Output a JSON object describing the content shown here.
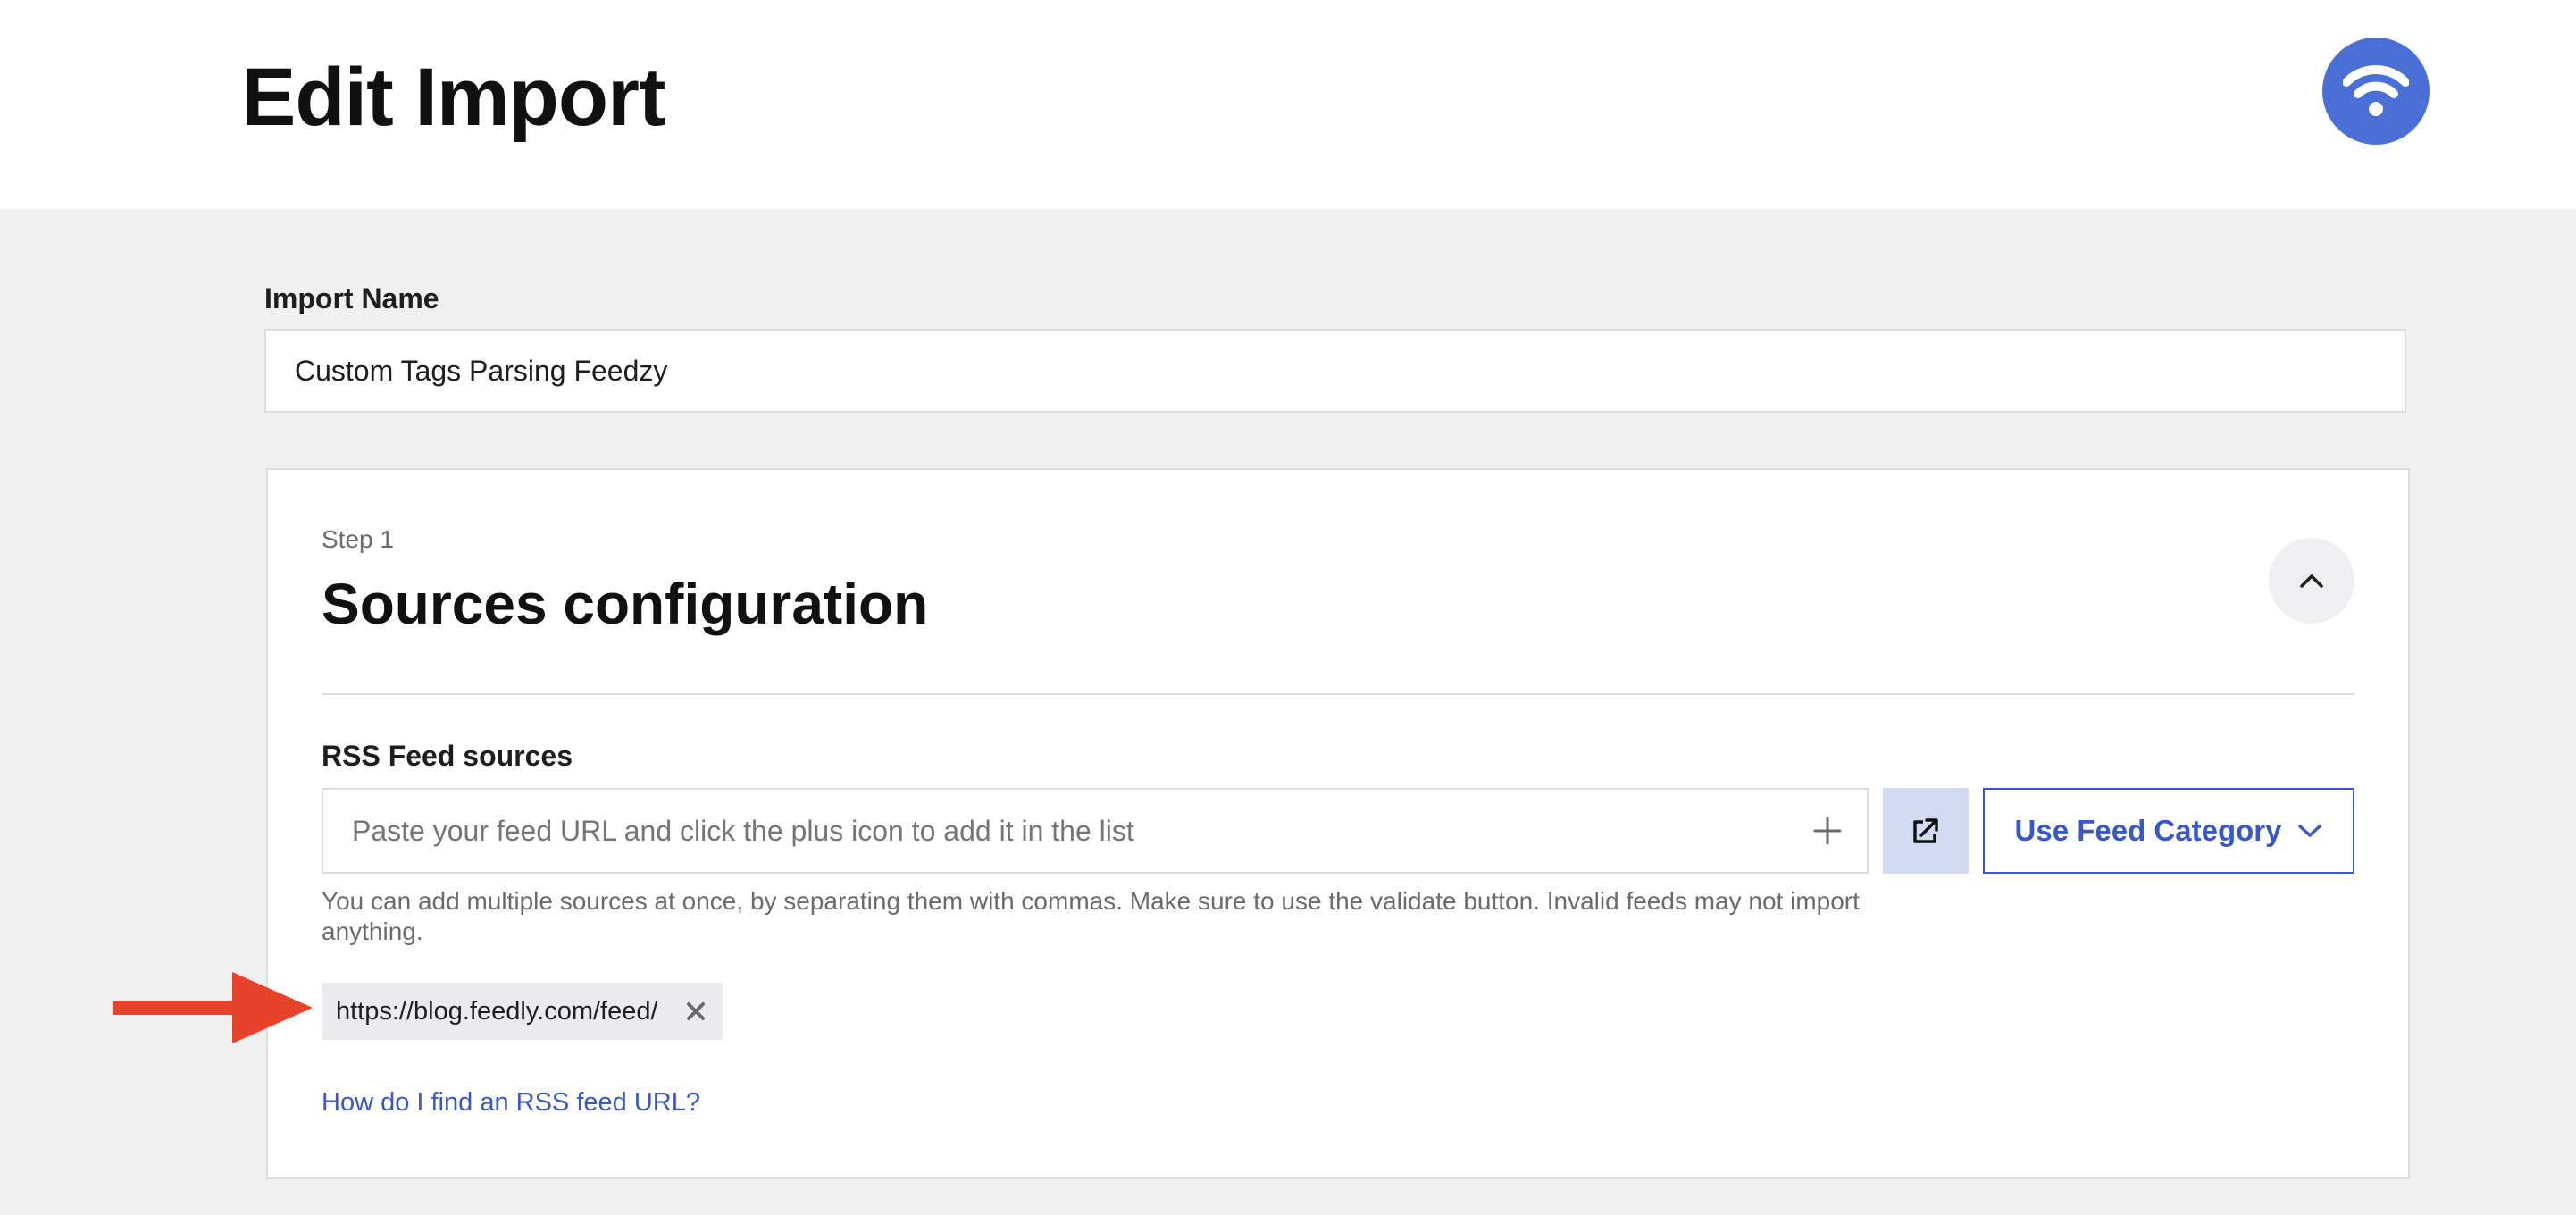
{
  "header": {
    "title": "Edit Import",
    "logo_icon": "wifi-icon",
    "logo_color": "#4a6fd6"
  },
  "import_name": {
    "label": "Import Name",
    "value": "Custom Tags Parsing Feedzy"
  },
  "step": {
    "label": "Step 1",
    "title": "Sources configuration",
    "collapse_icon": "chevron-up-icon"
  },
  "rss": {
    "label": "RSS Feed sources",
    "placeholder": "Paste your feed URL and click the plus icon to add it in the list",
    "add_icon": "plus-icon",
    "validate_icon": "external-link-icon",
    "category_button": "Use Feed Category",
    "category_icon": "chevron-down-icon",
    "help_text": "You can add multiple sources at once, by separating them with commas. Make sure to use the validate button. Invalid feeds may not import anything.",
    "tags": [
      {
        "label": "https://blog.feedly.com/feed/",
        "remove_icon": "close-icon"
      }
    ],
    "help_link": "How do I find an RSS feed URL?"
  },
  "annotation": {
    "arrow_icon": "arrow-right-icon",
    "arrow_color": "#e8422a"
  },
  "colors": {
    "accent": "#3858c9",
    "background": "#f0f0f0",
    "validate_bg": "#d3dbf3"
  }
}
